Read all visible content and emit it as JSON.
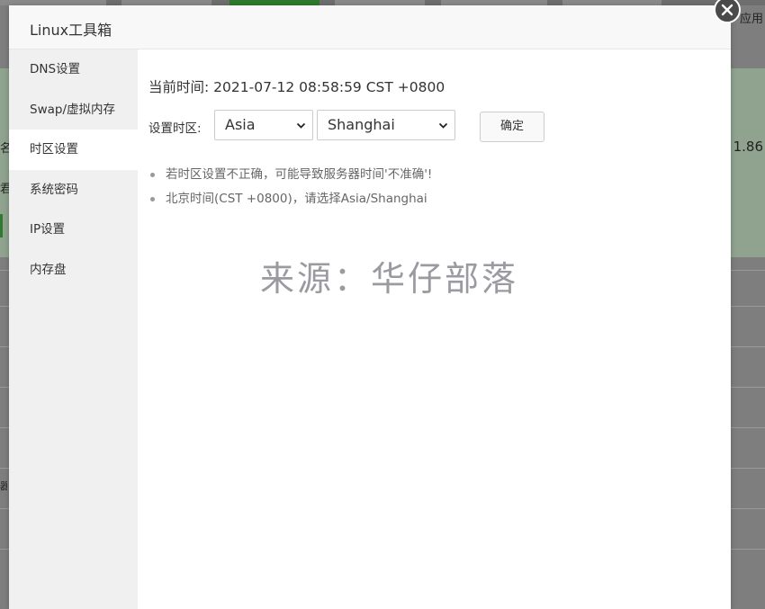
{
  "background": {
    "right_text_1": "应用",
    "right_text_2": "1.86",
    "left_fragments": [
      "名",
      "君",
      "器"
    ]
  },
  "modal": {
    "title": "Linux工具箱"
  },
  "sidebar": {
    "items": [
      {
        "label": "DNS设置"
      },
      {
        "label": "Swap/虚拟内存"
      },
      {
        "label": "时区设置"
      },
      {
        "label": "系统密码"
      },
      {
        "label": "IP设置"
      },
      {
        "label": "内存盘"
      }
    ],
    "active_index": 2
  },
  "timezone": {
    "current_time_label": "当前时间:",
    "current_time_value": "2021-07-12 08:58:59 CST +0800",
    "set_label": "设置时区:",
    "region_selected": "Asia",
    "city_selected": "Shanghai",
    "confirm_label": "确定",
    "tips": [
      "若时区设置不正确，可能导致服务器时间'不准确'!",
      "北京时间(CST +0800)，请选择Asia/Shanghai"
    ]
  },
  "watermark": "来源：华仔部落",
  "colors": {
    "accent_green": "#2f7a2f",
    "sidebar_bg": "#f0f0f0",
    "header_bg": "#f8f8f8"
  },
  "icons": {
    "close": "close-icon",
    "dropdown": "chevron-down-icon"
  }
}
